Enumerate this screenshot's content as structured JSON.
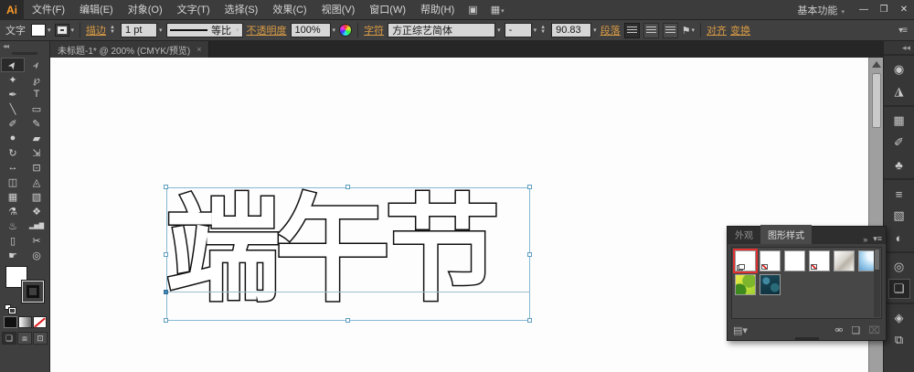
{
  "app": {
    "logo": "Ai",
    "workspace_label": "基本功能",
    "workspace_arrow": "▾"
  },
  "colors": {
    "accent_orange": "#d89a45",
    "selection_blue": "#86b9d4",
    "annotation_red": "#e03131",
    "canvas_white": "#fdfdfd",
    "ui_dark": "#3f3f3f"
  },
  "menubar": {
    "items": [
      {
        "label": "文件(F)"
      },
      {
        "label": "编辑(E)"
      },
      {
        "label": "对象(O)"
      },
      {
        "label": "文字(T)"
      },
      {
        "label": "选择(S)"
      },
      {
        "label": "效果(C)"
      },
      {
        "label": "视图(V)"
      },
      {
        "label": "窗口(W)"
      },
      {
        "label": "帮助(H)"
      }
    ],
    "bridge_glyph": "▣",
    "arrange_glyph": "▦",
    "arrange_arrow": "▾"
  },
  "window_controls": {
    "minimize": "—",
    "restore": "❒",
    "close": "✕"
  },
  "options": {
    "context_label": "文字",
    "stroke_label": "描边",
    "stroke_value": "1 pt",
    "profile_value": "等比",
    "opacity_label": "不透明度",
    "opacity_value": "100%",
    "character_label": "字符",
    "font_value": "方正综艺简体",
    "font_style_value": "-",
    "font_size_value": "90.83",
    "paragraph_label": "段落",
    "envelope_glyph": "⚑",
    "align_label": "对齐",
    "transform_label": "变换",
    "panel_menu_glyph": "▾≡"
  },
  "document_tab": {
    "title": "未标题-1* @ 200% (CMYK/预览)",
    "close": "×"
  },
  "canvas": {
    "text": "端午节"
  },
  "tools": [
    {
      "name": "selection-tool",
      "glyph": "➤"
    },
    {
      "name": "direct-selection-tool",
      "glyph": "➢"
    },
    {
      "name": "magic-wand-tool",
      "glyph": "✦"
    },
    {
      "name": "lasso-tool",
      "glyph": "℘"
    },
    {
      "name": "pen-tool",
      "glyph": "✒"
    },
    {
      "name": "type-tool",
      "glyph": "T"
    },
    {
      "name": "line-segment-tool",
      "glyph": "╲"
    },
    {
      "name": "rectangle-tool",
      "glyph": "▭"
    },
    {
      "name": "paintbrush-tool",
      "glyph": "✐"
    },
    {
      "name": "pencil-tool",
      "glyph": "✎"
    },
    {
      "name": "blob-brush-tool",
      "glyph": "●"
    },
    {
      "name": "eraser-tool",
      "glyph": "▰"
    },
    {
      "name": "rotate-tool",
      "glyph": "↻"
    },
    {
      "name": "scale-tool",
      "glyph": "⇲"
    },
    {
      "name": "width-tool",
      "glyph": "↔"
    },
    {
      "name": "free-transform-tool",
      "glyph": "⊡"
    },
    {
      "name": "shape-builder-tool",
      "glyph": "◫"
    },
    {
      "name": "perspective-grid-tool",
      "glyph": "◬"
    },
    {
      "name": "mesh-tool",
      "glyph": "▦"
    },
    {
      "name": "gradient-tool",
      "glyph": "▧"
    },
    {
      "name": "eyedropper-tool",
      "glyph": "⚗"
    },
    {
      "name": "blend-tool",
      "glyph": "❖"
    },
    {
      "name": "symbol-sprayer-tool",
      "glyph": "♨"
    },
    {
      "name": "column-graph-tool",
      "glyph": "▂▅▇"
    },
    {
      "name": "artboard-tool",
      "glyph": "▯"
    },
    {
      "name": "slice-tool",
      "glyph": "✂"
    },
    {
      "name": "hand-tool",
      "glyph": "☛"
    },
    {
      "name": "zoom-tool",
      "glyph": "◎"
    }
  ],
  "dock": {
    "collapse_glyph": "◂◂",
    "panels": [
      {
        "name": "color-panel",
        "glyph": "◉"
      },
      {
        "name": "color-guide-panel",
        "glyph": "◮"
      },
      {
        "name": "swatches-panel",
        "glyph": "▦"
      },
      {
        "name": "brushes-panel",
        "glyph": "✐"
      },
      {
        "name": "symbols-panel",
        "glyph": "♣"
      },
      {
        "name": "stroke-panel",
        "glyph": "≡"
      },
      {
        "name": "gradient-panel",
        "glyph": "▧"
      },
      {
        "name": "transparency-panel",
        "glyph": "◐"
      },
      {
        "name": "appearance-panel",
        "glyph": "◎"
      },
      {
        "name": "graphic-styles-panel",
        "glyph": "❏"
      },
      {
        "name": "layers-panel",
        "glyph": "◈"
      },
      {
        "name": "artboards-panel",
        "glyph": "⧉"
      }
    ]
  },
  "graphic_styles": {
    "tab_appearance": "外观",
    "tab_styles": "图形样式",
    "expand_glyph": "»",
    "menu_glyph": "▾≡",
    "styles": [
      {
        "name": "default-graphic-style"
      },
      {
        "name": "style-no-fill-slash"
      },
      {
        "name": "style-plain-white"
      },
      {
        "name": "style-box-slash"
      },
      {
        "name": "style-silver-bevel"
      },
      {
        "name": "style-blue-gloss"
      },
      {
        "name": "style-green-leaf"
      },
      {
        "name": "style-teal-swirl"
      }
    ],
    "footer": {
      "library_glyph": "▤▾",
      "break_link_glyph": "⚮",
      "new_style_glyph": "❏",
      "delete_glyph": "⌧"
    }
  }
}
